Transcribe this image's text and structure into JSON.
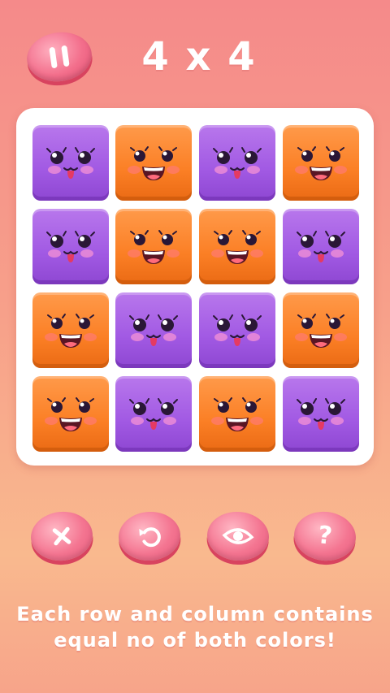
{
  "header": {
    "pause_icon": "pause-icon",
    "title": "4 x 4"
  },
  "board": {
    "size": "4 x 4",
    "rows": [
      [
        "purple",
        "orange",
        "purple",
        "orange"
      ],
      [
        "purple",
        "orange",
        "orange",
        "purple"
      ],
      [
        "orange",
        "purple",
        "purple",
        "orange"
      ],
      [
        "orange",
        "purple",
        "orange",
        "purple"
      ]
    ],
    "colors": {
      "purple": "#a159e3",
      "orange": "#fb7f25"
    }
  },
  "controls": [
    {
      "name": "clear-button",
      "icon": "close-icon"
    },
    {
      "name": "undo-button",
      "icon": "undo-icon"
    },
    {
      "name": "reveal-button",
      "icon": "eye-icon"
    },
    {
      "name": "help-button",
      "icon": "question-icon",
      "glyph": "?"
    }
  ],
  "hint": {
    "line1": "Each row and column contains",
    "line2": "equal no of both colors!"
  }
}
